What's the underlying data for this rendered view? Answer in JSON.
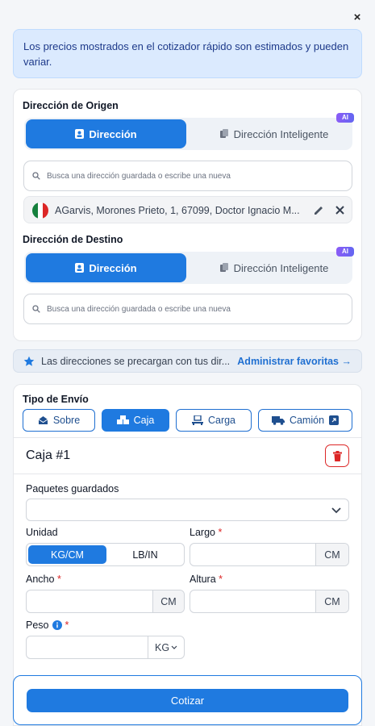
{
  "close_label": "×",
  "banner": {
    "text": "Los precios mostrados en el cotizador rápido son estimados y pueden variar."
  },
  "origin": {
    "title": "Dirección de Origen",
    "tab_direccion": "Dirección",
    "tab_inteligente": "Dirección Inteligente",
    "ai_badge": "AI",
    "search_placeholder": "Busca una dirección guardada o escribe una nueva",
    "selected_address": "AGarvis, Morones Prieto, 1, 67099, Doctor Ignacio M..."
  },
  "destination": {
    "title": "Dirección de Destino",
    "tab_direccion": "Dirección",
    "tab_inteligente": "Dirección Inteligente",
    "ai_badge": "AI",
    "search_placeholder": "Busca una dirección guardada o escribe una nueva"
  },
  "favorites": {
    "text": "Las direcciones se precargan con tus dir...",
    "link": "Administrar favoritas →"
  },
  "shipping": {
    "title": "Tipo de Envío",
    "types": [
      "Sobre",
      "Caja",
      "Carga",
      "Camión"
    ],
    "selected": "Caja"
  },
  "box": {
    "title": "Caja #1",
    "saved_packages_label": "Paquetes guardados",
    "unit_label": "Unidad",
    "unit_options": [
      "KG/CM",
      "LB/IN"
    ],
    "largo_label": "Largo",
    "ancho_label": "Ancho",
    "altura_label": "Altura",
    "peso_label": "Peso",
    "required_mark": "*",
    "cm_unit": "CM",
    "kg_unit": "KG"
  },
  "actions": {
    "cotizar": "Cotizar"
  },
  "colors": {
    "primary": "#1f7ae0",
    "danger": "#dc2626",
    "banner_bg": "#dbeafe"
  }
}
